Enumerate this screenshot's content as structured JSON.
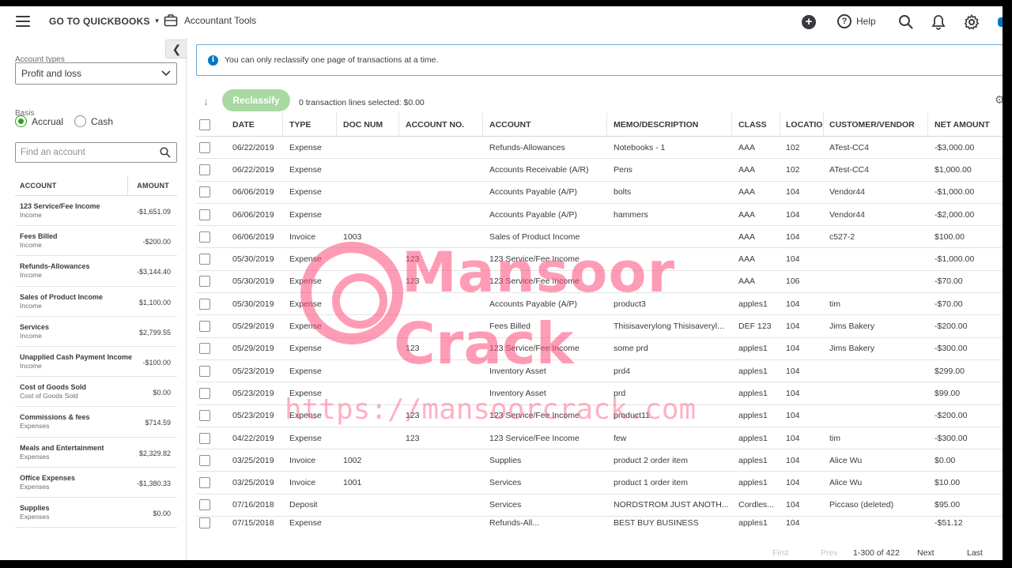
{
  "nav": {
    "goto_label": "GO TO QUICKBOOKS",
    "accountant_tools_label": "Accountant Tools",
    "help_label": "Help"
  },
  "left": {
    "account_types_label": "Account types",
    "account_type_value": "Profit and loss",
    "basis_label": "Basis",
    "basis_options": [
      "Accrual",
      "Cash"
    ],
    "basis_selected": "Accrual",
    "find_placeholder": "Find an account",
    "col_account": "ACCOUNT",
    "col_amount": "AMOUNT",
    "accounts": [
      {
        "name": "123 Service/Fee Income",
        "type": "Income",
        "amount": "-$1,651.09"
      },
      {
        "name": "Fees Billed",
        "type": "Income",
        "amount": "-$200.00"
      },
      {
        "name": "Refunds-Allowances",
        "type": "Income",
        "amount": "-$3,144.40"
      },
      {
        "name": "Sales of Product Income",
        "type": "Income",
        "amount": "$1,100.00"
      },
      {
        "name": "Services",
        "type": "Income",
        "amount": "$2,799.55"
      },
      {
        "name": "Unapplied Cash Payment Income",
        "type": "Income",
        "amount": "-$100.00"
      },
      {
        "name": "Cost of Goods Sold",
        "type": "Cost of Goods Sold",
        "amount": "$0.00"
      },
      {
        "name": "Commissions & fees",
        "type": "Expenses",
        "amount": "$714.59"
      },
      {
        "name": "Meals and Entertainment",
        "type": "Expenses",
        "amount": "$2,329.82"
      },
      {
        "name": "Office Expenses",
        "type": "Expenses",
        "amount": "-$1,380.33"
      },
      {
        "name": "Supplies",
        "type": "Expenses",
        "amount": "$0.00"
      }
    ]
  },
  "main": {
    "info_text": "You can only reclassify one page of transactions at a time.",
    "reclassify_label": "Reclassify",
    "selected_text": "0 transaction lines selected: $0.00",
    "columns": {
      "date": "DATE",
      "type": "TYPE",
      "doc": "DOC NUM",
      "accno": "ACCOUNT NO.",
      "account": "ACCOUNT",
      "memo": "MEMO/DESCRIPTION",
      "class": "CLASS",
      "location": "LOCATIO",
      "customer": "CUSTOMER/VENDOR",
      "net": "NET AMOUNT"
    },
    "rows": [
      {
        "date": "06/22/2019",
        "type": "Expense",
        "doc": "",
        "accno": "",
        "account": "Refunds-Allowances",
        "memo": "Notebooks - 1",
        "class": "AAA",
        "location": "102",
        "customer": "ATest-CC4",
        "net": "-$3,000.00"
      },
      {
        "date": "06/22/2019",
        "type": "Expense",
        "doc": "",
        "accno": "",
        "account": "Accounts Receivable (A/R)",
        "memo": "Pens",
        "class": "AAA",
        "location": "102",
        "customer": "ATest-CC4",
        "net": "$1,000.00"
      },
      {
        "date": "06/06/2019",
        "type": "Expense",
        "doc": "",
        "accno": "",
        "account": "Accounts Payable (A/P)",
        "memo": "bolts",
        "class": "AAA",
        "location": "104",
        "customer": "Vendor44",
        "net": "-$1,000.00"
      },
      {
        "date": "06/06/2019",
        "type": "Expense",
        "doc": "",
        "accno": "",
        "account": "Accounts Payable (A/P)",
        "memo": "hammers",
        "class": "AAA",
        "location": "104",
        "customer": "Vendor44",
        "net": "-$2,000.00"
      },
      {
        "date": "06/06/2019",
        "type": "Invoice",
        "doc": "1003",
        "accno": "",
        "account": "Sales of Product Income",
        "memo": "",
        "class": "AAA",
        "location": "104",
        "customer": "c527-2",
        "net": "$100.00"
      },
      {
        "date": "05/30/2019",
        "type": "Expense",
        "doc": "",
        "accno": "123",
        "account": "123 Service/Fee Income",
        "memo": "",
        "class": "AAA",
        "location": "104",
        "customer": "",
        "net": "-$1,000.00"
      },
      {
        "date": "05/30/2019",
        "type": "Expense",
        "doc": "",
        "accno": "123",
        "account": "123 Service/Fee Income",
        "memo": "",
        "class": "AAA",
        "location": "106",
        "customer": "",
        "net": "-$70.00"
      },
      {
        "date": "05/30/2019",
        "type": "Expense",
        "doc": "",
        "accno": "",
        "account": "Accounts Payable (A/P)",
        "memo": "product3",
        "class": "apples1",
        "location": "104",
        "customer": "tim",
        "net": "-$70.00"
      },
      {
        "date": "05/29/2019",
        "type": "Expense",
        "doc": "",
        "accno": "",
        "account": "Fees Billed",
        "memo": "Thisisaverylong Thisisaveryl...",
        "class": "DEF 123",
        "location": "104",
        "customer": "Jims Bakery",
        "net": "-$200.00"
      },
      {
        "date": "05/29/2019",
        "type": "Expense",
        "doc": "",
        "accno": "123",
        "account": "123 Service/Fee Income",
        "memo": "some prd",
        "class": "apples1",
        "location": "104",
        "customer": "Jims Bakery",
        "net": "-$300.00"
      },
      {
        "date": "05/23/2019",
        "type": "Expense",
        "doc": "",
        "accno": "",
        "account": "Inventory Asset",
        "memo": "prd4",
        "class": "apples1",
        "location": "104",
        "customer": "",
        "net": "$299.00"
      },
      {
        "date": "05/23/2019",
        "type": "Expense",
        "doc": "",
        "accno": "",
        "account": "Inventory Asset",
        "memo": "prd",
        "class": "apples1",
        "location": "104",
        "customer": "",
        "net": "$99.00"
      },
      {
        "date": "05/23/2019",
        "type": "Expense",
        "doc": "",
        "accno": "123",
        "account": "123 Service/Fee Income",
        "memo": "product11",
        "class": "apples1",
        "location": "104",
        "customer": "",
        "net": "-$200.00"
      },
      {
        "date": "04/22/2019",
        "type": "Expense",
        "doc": "",
        "accno": "123",
        "account": "123 Service/Fee Income",
        "memo": "few",
        "class": "apples1",
        "location": "104",
        "customer": "tim",
        "net": "-$300.00"
      },
      {
        "date": "03/25/2019",
        "type": "Invoice",
        "doc": "1002",
        "accno": "",
        "account": "Supplies",
        "memo": "product 2 order item",
        "class": "apples1",
        "location": "104",
        "customer": "Alice Wu",
        "net": "$0.00"
      },
      {
        "date": "03/25/2019",
        "type": "Invoice",
        "doc": "1001",
        "accno": "",
        "account": "Services",
        "memo": "product 1 order item",
        "class": "apples1",
        "location": "104",
        "customer": "Alice Wu",
        "net": "$10.00"
      },
      {
        "date": "07/16/2018",
        "type": "Deposit",
        "doc": "",
        "accno": "",
        "account": "Services",
        "memo": "NORDSTROM JUST ANOTH...",
        "class": "Cordles...",
        "location": "104",
        "customer": "Piccaso (deleted)",
        "net": "$95.00"
      },
      {
        "date": "07/15/2018",
        "type": "Expense",
        "doc": "",
        "accno": "",
        "account": "Refunds-All...",
        "memo": "BEST BUY BUSINESS",
        "class": "apples1",
        "location": "104",
        "customer": "",
        "net": "-$51.12"
      }
    ],
    "pager": {
      "first": "First",
      "prev": "Prev",
      "range": "1-300 of 422",
      "next": "Next",
      "last": "Last"
    }
  },
  "watermark": {
    "line1": "Mansoor",
    "line2": "Crack",
    "url": "https://mansoorcrack.com"
  },
  "colors": {
    "accent_green": "#2ca01c",
    "reclassify_disabled": "#a9d8a2",
    "info_blue": "#0077c5",
    "watermark_pink": "#ff4d7a"
  }
}
